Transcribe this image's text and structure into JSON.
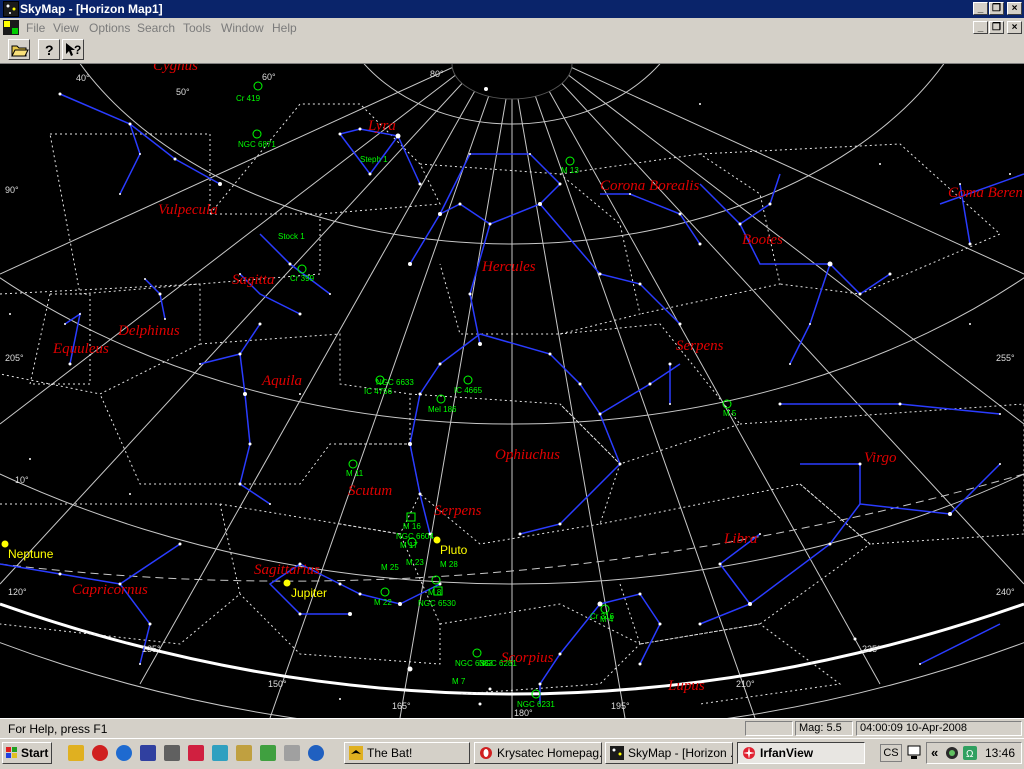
{
  "window": {
    "title": "SkyMap - [Horizon Map1]",
    "controls": {
      "minimize": "_",
      "restore": "❐",
      "close": "×"
    }
  },
  "menu": {
    "items": [
      "File",
      "View",
      "Options",
      "Search",
      "Tools",
      "Window",
      "Help"
    ]
  },
  "toolbar": {
    "open_icon": "folder-open-icon",
    "help_icon": "help-icon",
    "context_help_icon": "context-help-icon"
  },
  "map": {
    "constellations": [
      "Cygnus",
      "Lyra",
      "Vulpecula",
      "Sagitta",
      "Delphinus",
      "Equuleus",
      "Aquila",
      "Hercules",
      "Corona Borealis",
      "Bootes",
      "Coma Beren",
      "Serpens",
      "Ophiuchus",
      "Scutum",
      "Serpens",
      "Virgo",
      "Libra",
      "Sagittarius",
      "Capricornus",
      "Scorpius",
      "Lupus"
    ],
    "objects": [
      "Cr 419",
      "NGC 6871",
      "Steph 1",
      "M 13",
      "Stock 1",
      "Cr 399",
      "NGC 6633",
      "IC 4756",
      "IC 4665",
      "Mel 186",
      "M 5",
      "M 11",
      "M 16",
      "NGC 6604",
      "M 17",
      "M 28",
      "M 25",
      "M 22",
      "M 23",
      "NGC 6530",
      "M 8",
      "M 4",
      "Cr 316",
      "NGC 6231",
      "NGC 6383",
      "M 7",
      "NGC 6281"
    ],
    "planets": [
      "Neptune",
      "Pluto",
      "Jupiter"
    ],
    "ticks": [
      "40°",
      "60°",
      "80°",
      "50°",
      "90°",
      "205°",
      "255°",
      "10°",
      "120°",
      "135°",
      "150°",
      "165°",
      "180°",
      "195°",
      "210°",
      "225°",
      "240°"
    ]
  },
  "status": {
    "help": "For Help, press F1",
    "mag": "Mag: 5.5",
    "datetime": "04:00:09 10-Apr-2008"
  },
  "taskbar": {
    "start": "Start",
    "tasks": [
      "The Bat!",
      "Krysatec Homepag...",
      "SkyMap - [Horizon ...",
      "IrfanView"
    ],
    "lang": "CS",
    "chevron": "«",
    "clock": "13:46"
  },
  "colors": {
    "titlebar": "#0a246a",
    "map_bg": "#000000",
    "constellation_label": "#e00000",
    "deep_sky": "#00ff00",
    "planet": "#ffff00",
    "constellation_line": "#2a3cff"
  }
}
